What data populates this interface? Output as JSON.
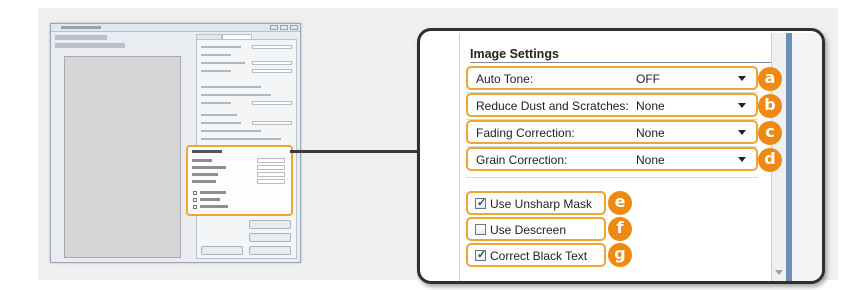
{
  "image_settings": {
    "title": "Image Settings",
    "rows": [
      {
        "label": "Auto Tone:",
        "value": "OFF",
        "badge": "a"
      },
      {
        "label": "Reduce Dust and Scratches:",
        "value": "None",
        "badge": "b"
      },
      {
        "label": "Fading Correction:",
        "value": "None",
        "badge": "c"
      },
      {
        "label": "Grain Correction:",
        "value": "None",
        "badge": "d"
      }
    ],
    "checkboxes": [
      {
        "label": "Use Unsharp Mask",
        "checked": true,
        "badge": "e"
      },
      {
        "label": "Use Descreen",
        "checked": false,
        "badge": "f"
      },
      {
        "label": "Correct Black Text",
        "checked": true,
        "badge": "g"
      }
    ]
  },
  "colors": {
    "highlight": "#f0a532",
    "badge": "#ee8a12",
    "frame_accent": "#6f8fb0"
  },
  "icons": {
    "dropdown": "chevron-down-icon",
    "checkbox": "checkmark-icon",
    "scroll": "scroll-down-arrow-icon"
  }
}
